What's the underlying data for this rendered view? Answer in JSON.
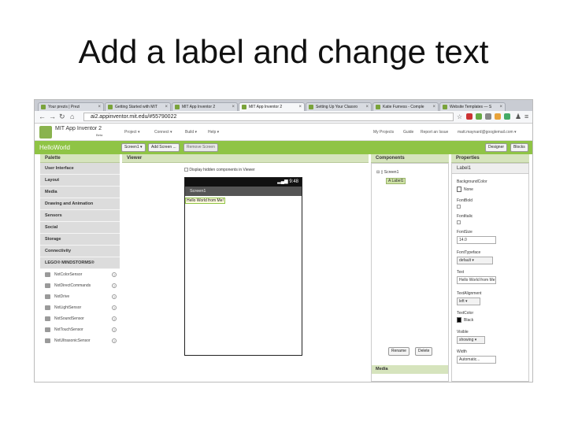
{
  "slide": {
    "title": "Add a label and change text"
  },
  "browser": {
    "tabs": [
      {
        "label": "Your prezis | Prezi",
        "active": false
      },
      {
        "label": "Getting Started with MIT",
        "active": false
      },
      {
        "label": "MIT App Inventor 2",
        "active": false
      },
      {
        "label": "MIT App Inventor 2",
        "active": true
      },
      {
        "label": "Setting Up Your Classro",
        "active": false
      },
      {
        "label": "Katie Furness - Comple",
        "active": false
      },
      {
        "label": "Website Templates — S",
        "active": false
      }
    ],
    "url": "ai2.appinventor.mit.edu/#55790022"
  },
  "app": {
    "brand": "MIT App Inventor 2",
    "beta": "Beta",
    "menus": [
      "Project ▾",
      "Connect ▾",
      "Build ▾",
      "Help ▾"
    ],
    "right_links": [
      "My Projects",
      "Guide",
      "Report an Issue",
      "matt.maynard@googlemail.com ▾"
    ]
  },
  "toolbar": {
    "project_name": "HelloWorld",
    "screen_select": "Screen1 ▾",
    "add_screen": "Add Screen ...",
    "remove_screen": "Remove Screen",
    "designer": "Designer",
    "blocks": "Blocks"
  },
  "palette": {
    "header": "Palette",
    "categories": [
      "User Interface",
      "Layout",
      "Media",
      "Drawing and Animation",
      "Sensors",
      "Social",
      "Storage",
      "Connectivity",
      "LEGO® MINDSTORMS®"
    ],
    "items": [
      "NxtColorSensor",
      "NxtDirectCommands",
      "NxtDrive",
      "NxtLightSensor",
      "NxtSoundSensor",
      "NxtTouchSensor",
      "NxtUltrasonicSensor"
    ]
  },
  "viewer": {
    "header": "Viewer",
    "hidden_toggle": "Display hidden components in Viewer",
    "status_time": "9:48",
    "screen_title": "Screen1",
    "label_text": "Hello World from Me!"
  },
  "components": {
    "header": "Components",
    "tree": [
      "Screen1",
      "Label1"
    ],
    "rename": "Rename",
    "delete": "Delete",
    "media_header": "Media"
  },
  "properties": {
    "header": "Properties",
    "component": "Label1",
    "background_color_label": "BackgroundColor",
    "background_color_value": "None",
    "font_bold_label": "FontBold",
    "font_italic_label": "FontItalic",
    "font_size_label": "FontSize",
    "font_size_value": "14.0",
    "font_typeface_label": "FontTypeface",
    "font_typeface_value": "default ▾",
    "text_label": "Text",
    "text_value": "Hello World from Me",
    "text_alignment_label": "TextAlignment",
    "text_alignment_value": "left ▾",
    "text_color_label": "TextColor",
    "text_color_value": "Black",
    "visible_label": "Visible",
    "visible_value": "showing ▾",
    "width_label": "Width",
    "width_value": "Automatic..."
  },
  "colors": {
    "accent_green": "#8fc445",
    "header_green": "#d6e4bd"
  }
}
